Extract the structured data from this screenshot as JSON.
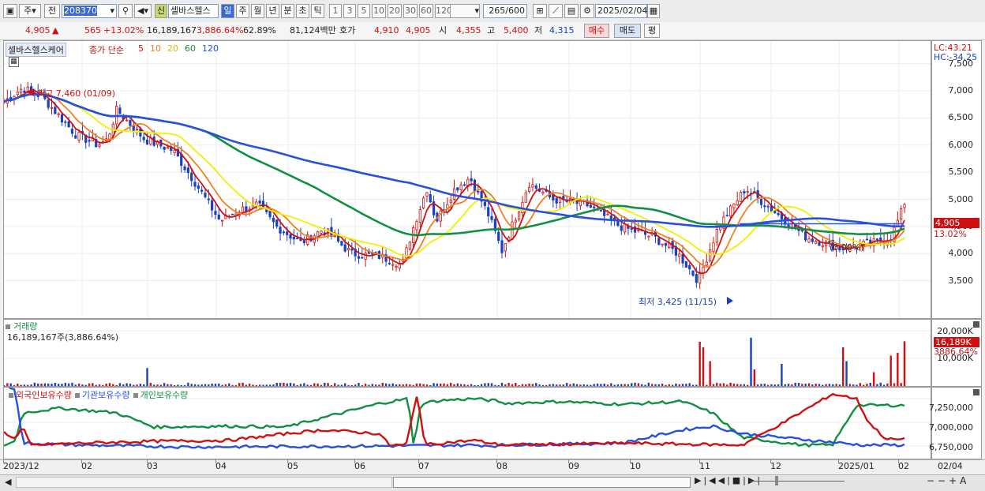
{
  "toolbar": {
    "market_label": "주",
    "prev_label": "전",
    "stock_code": "208370",
    "new_badge": "신",
    "stock_name": "셀바스헬스",
    "periods": [
      "일",
      "주",
      "월",
      "년",
      "분",
      "초",
      "틱"
    ],
    "active_period": "일",
    "intervals": [
      "1",
      "3",
      "5",
      "10",
      "20",
      "30",
      "60",
      "120"
    ],
    "count_value": "265",
    "count_total": "/600",
    "date_value": "2025/02/04"
  },
  "quote": {
    "price": "4,905",
    "change_arrow": "▲",
    "change": "565",
    "change_pct": "+13.02%",
    "volume": "16,189,167",
    "volume_pct": "3,886.64%",
    "turnover_pct": "62.89%",
    "amount": "81,124백만",
    "bid_label": "호가",
    "bid1": "4,910",
    "bid2": "4,905",
    "open_label": "시",
    "open": "4,355",
    "high_label": "고",
    "high": "5,400",
    "low_label": "저",
    "low": "4,315",
    "buy_button": "매수",
    "sell_button": "매도",
    "eval_button": "평"
  },
  "price_pane": {
    "title": "셀바스헬스케어",
    "ma_label": "종가 단순",
    "ma_periods": [
      "5",
      "10",
      "20",
      "60",
      "120"
    ],
    "ma_colors": [
      "#d01010",
      "#f08020",
      "#f0f000",
      "#109040",
      "#2850e0"
    ],
    "high_annotation": "최고 7,460 (01/09)",
    "low_annotation": "최저 3,425 (11/15)",
    "hline_label": "(0.00%)",
    "lc": "LC:43.21",
    "hc": "HC:-34.25",
    "y_ticks": [
      "7,500",
      "7,000",
      "6,500",
      "6,000",
      "5,500",
      "5,000",
      "4,500",
      "4,000",
      "3,500"
    ],
    "current_price_tag": "4,905",
    "current_pct_tag": "13.02%"
  },
  "volume_pane": {
    "title": "거래량",
    "value_text": "16,189,167주(3,886.64%)",
    "y_ticks": [
      "20,000K",
      "10,000K"
    ],
    "current_tag": "16,189K",
    "current_pct_tag": "3886.64%"
  },
  "holding_pane": {
    "titles": [
      "외국인보유수량",
      "기관보유수량",
      "개인보유수량"
    ],
    "title_colors": [
      "#d01010",
      "#2850e0",
      "#109040"
    ],
    "y_ticks": [
      "7,250,000",
      "7,000,000",
      "6,750,000"
    ]
  },
  "x_axis": [
    "2023/12",
    "02",
    "03",
    "04",
    "05",
    "06",
    "07",
    "08",
    "09",
    "10",
    "11",
    "12",
    "2025/01",
    "02"
  ],
  "x_axis_right": "02/04",
  "colors": {
    "up": "#d01010",
    "down": "#1840c0",
    "accent": "#2850e0"
  }
}
